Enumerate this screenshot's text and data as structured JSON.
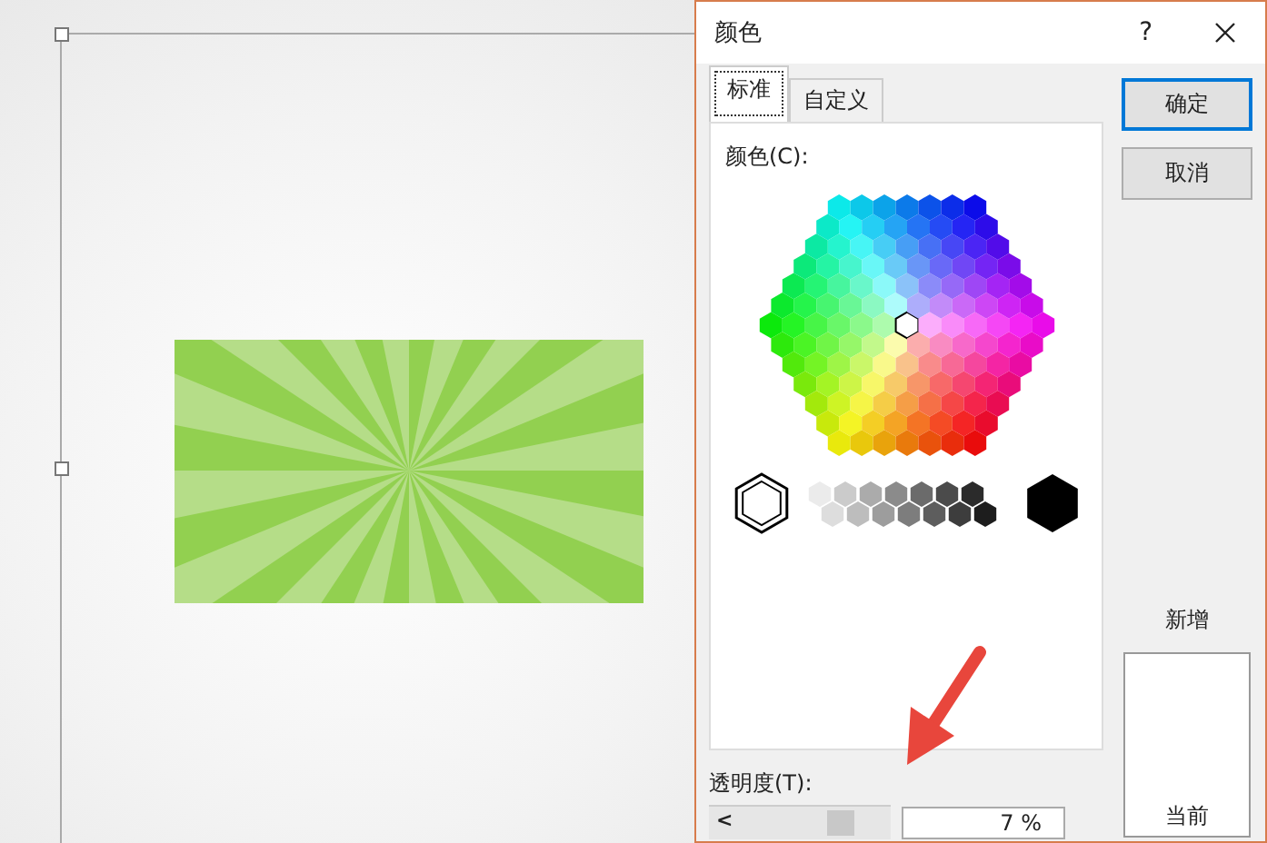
{
  "dialog": {
    "title": "颜色",
    "help": "?"
  },
  "tabs": [
    {
      "label": "标准",
      "selected": true
    },
    {
      "label": "自定义",
      "selected": false
    }
  ],
  "colors_label": "颜色(C):",
  "buttons": [
    {
      "label": "确定",
      "default": true
    },
    {
      "label": "取消",
      "default": false
    }
  ],
  "new_label": "新增",
  "current_label": "当前",
  "transparency": {
    "label": "透明度(T):",
    "left_arrow": "<",
    "level": 0.77,
    "value": "7 %"
  }
}
